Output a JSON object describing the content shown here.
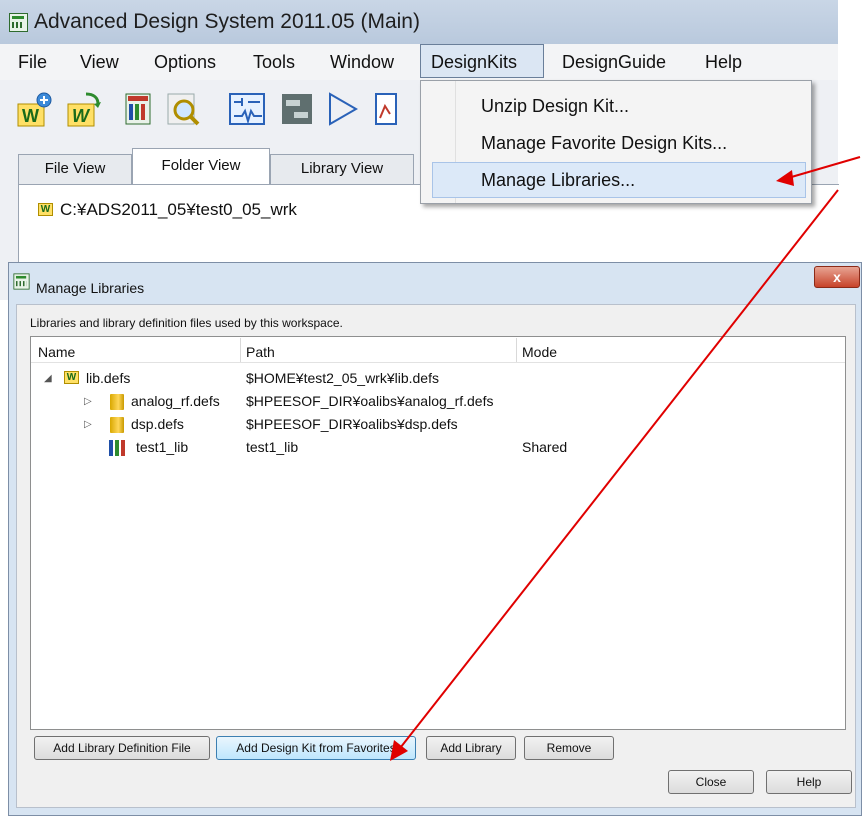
{
  "app": {
    "title": "Advanced Design System 2011.05 (Main)",
    "menu": [
      "File",
      "View",
      "Options",
      "Tools",
      "Window",
      "DesignKits",
      "DesignGuide",
      "Help"
    ],
    "active_menu": "DesignKits",
    "tabs": [
      "File View",
      "Folder View",
      "Library View"
    ],
    "active_tab": "Folder View",
    "workspace_path": "C:¥ADS2011_05¥test0_05_wrk"
  },
  "dropdown": {
    "items": [
      "Unzip Design Kit...",
      "Manage Favorite Design Kits...",
      "Manage Libraries..."
    ],
    "highlighted": "Manage Libraries..."
  },
  "dialog": {
    "title": "Manage Libraries",
    "description": "Libraries and library definition files used by this workspace.",
    "columns": [
      "Name",
      "Path",
      "Mode"
    ],
    "rows": [
      {
        "name": "lib.defs",
        "path": "$HOME¥test2_05_wrk¥lib.defs",
        "mode": ""
      },
      {
        "name": "analog_rf.defs",
        "path": "$HPEESOF_DIR¥oalibs¥analog_rf.defs",
        "mode": ""
      },
      {
        "name": "dsp.defs",
        "path": "$HPEESOF_DIR¥oalibs¥dsp.defs",
        "mode": ""
      },
      {
        "name": "test1_lib",
        "path": "test1_lib",
        "mode": "Shared"
      }
    ],
    "buttons": {
      "add_def_file": "Add Library Definition File",
      "add_kit_favorites": "Add Design Kit from Favorites",
      "add_library": "Add Library",
      "remove": "Remove",
      "close": "Close",
      "help": "Help"
    },
    "close_glyph": "x"
  },
  "annotation": {
    "arrow_color": "#e00000"
  }
}
